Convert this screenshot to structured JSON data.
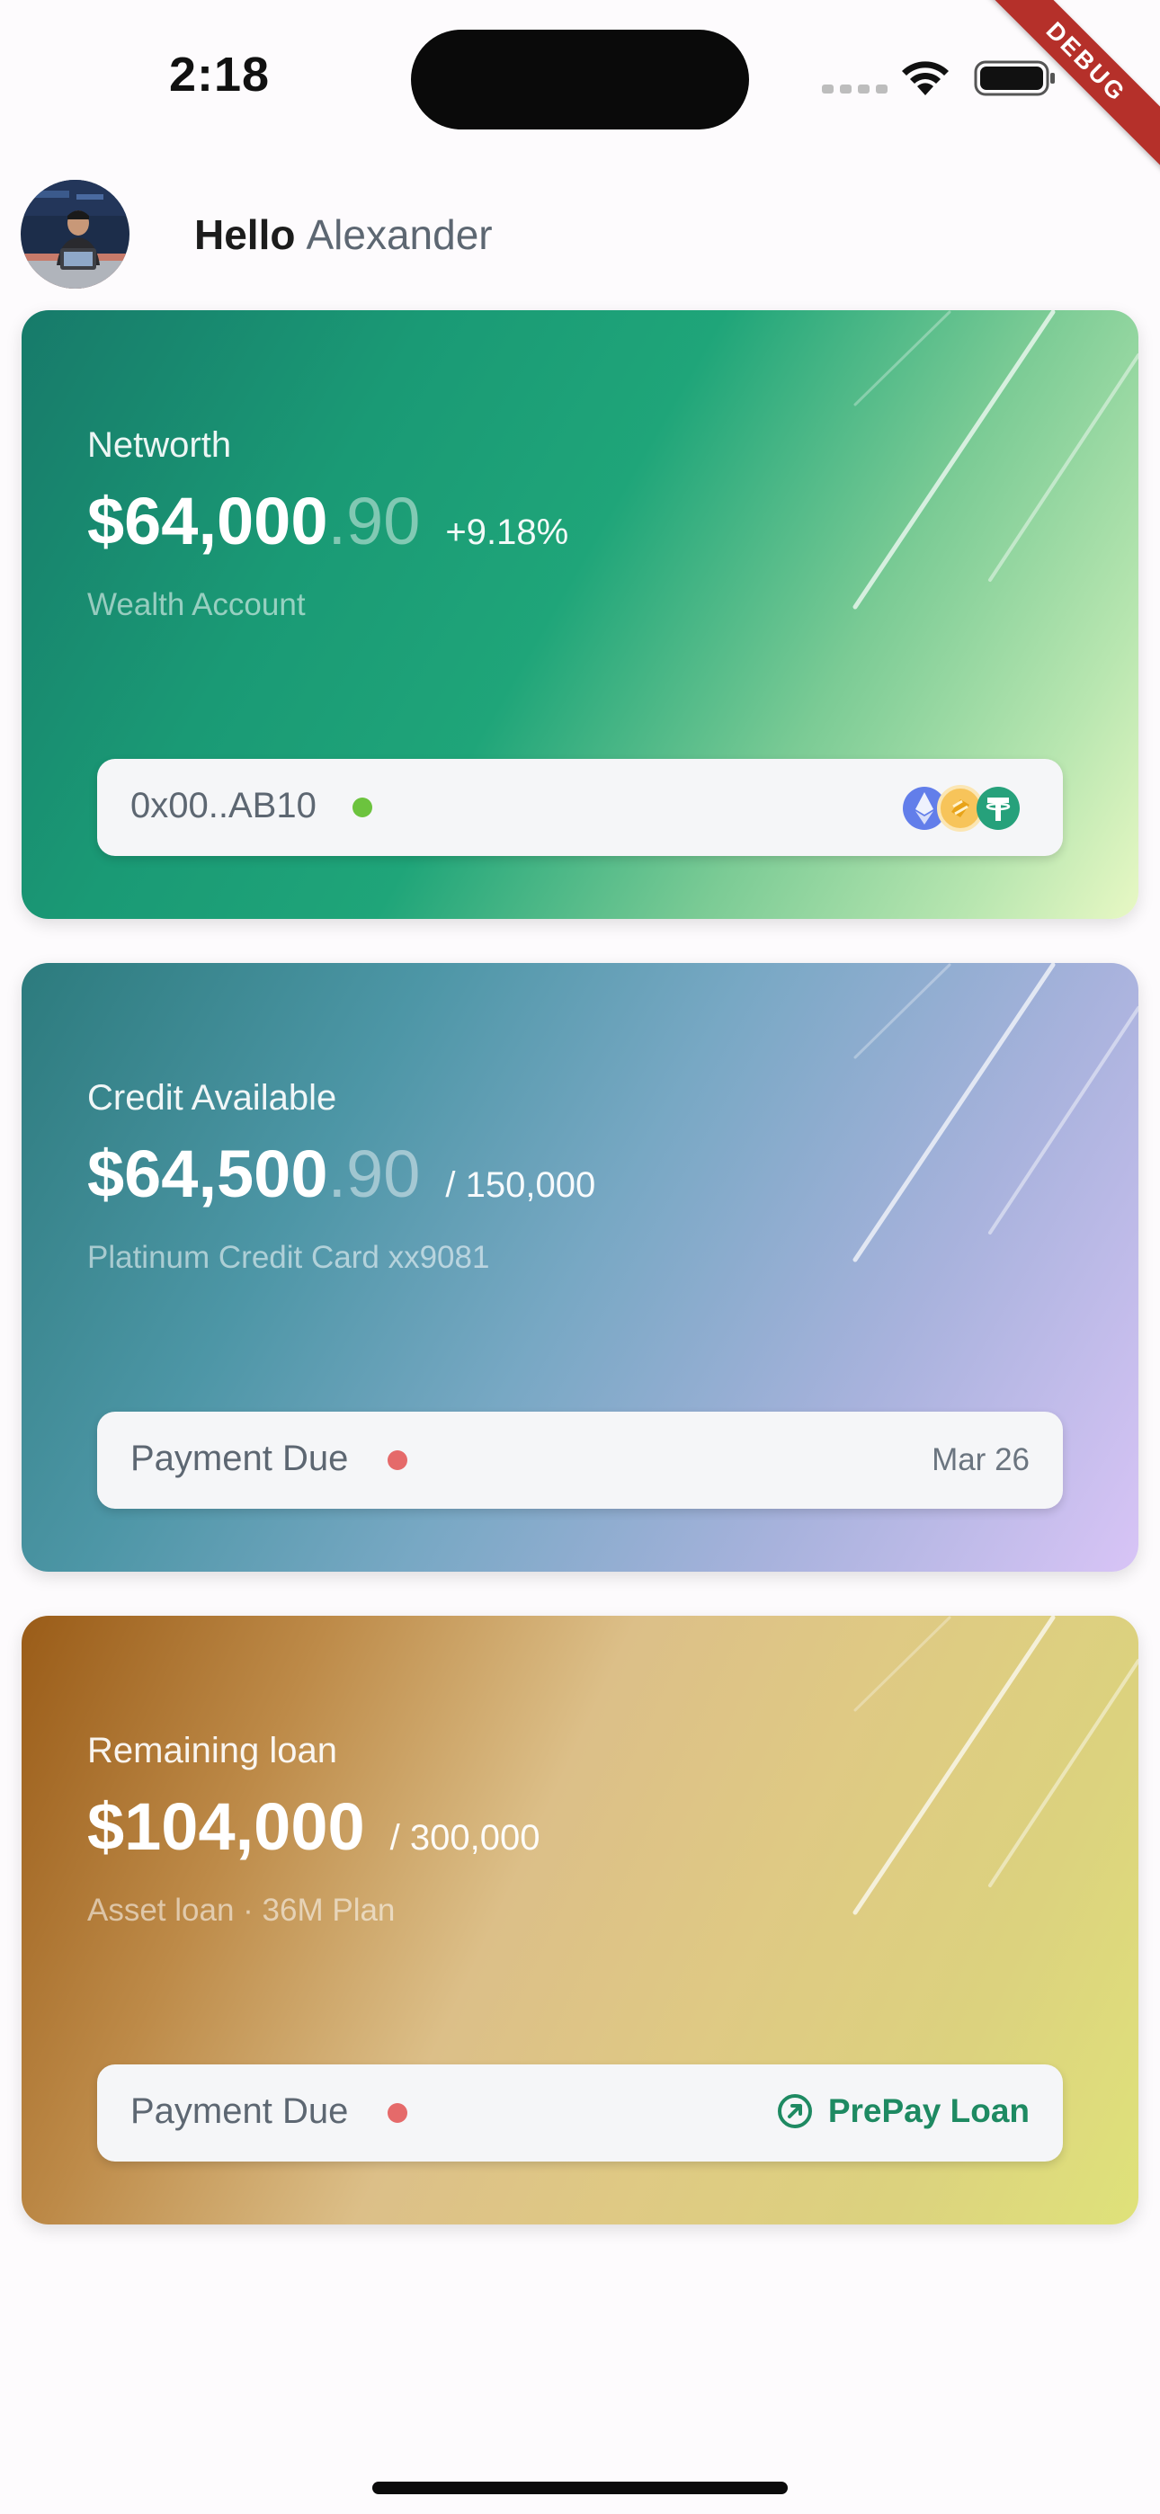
{
  "status_bar": {
    "time": "2:18",
    "debug_label": "DEBUG"
  },
  "header": {
    "hello": "Hello",
    "name": "Alexander"
  },
  "networth_card": {
    "label": "Networth",
    "amount_main": "$64,000",
    "amount_cents": ".90",
    "change": "+9.18%",
    "sub": "Wealth Account",
    "wallet_address": "0x00..AB10",
    "status_color": "#6cc33e",
    "coin_icons": [
      "ethereum-icon",
      "bitcoin-icon",
      "tether-icon"
    ]
  },
  "credit_card": {
    "label": "Credit Available",
    "amount_main": "$64,500",
    "amount_cents": ".90",
    "limit": "/ 150,000",
    "sub": "Platinum Credit Card xx9081",
    "pill_label": "Payment Due",
    "due_date": "Mar 26",
    "status_color": "#e56a6a"
  },
  "loan_card": {
    "label": "Remaining loan",
    "amount_main": "$104,000",
    "total": "/ 300,000",
    "sub": "Asset loan · 36M Plan",
    "pill_label": "Payment Due",
    "action_label": "PrePay Loan",
    "status_color": "#e56a6a",
    "accent_color": "#1e8a62"
  }
}
